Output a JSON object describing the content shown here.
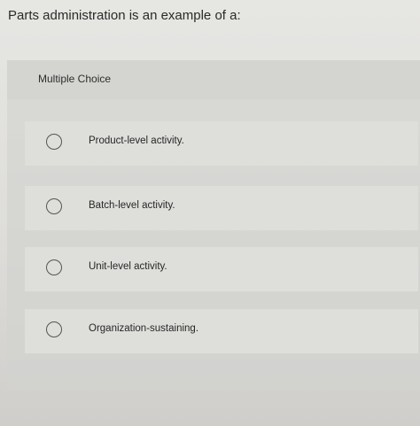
{
  "question": {
    "text": "Parts administration is an example of a:"
  },
  "question_type": {
    "label": "Multiple Choice"
  },
  "options": [
    {
      "label": "Product-level activity."
    },
    {
      "label": "Batch-level activity."
    },
    {
      "label": "Unit-level activity."
    },
    {
      "label": "Organization-sustaining."
    }
  ]
}
